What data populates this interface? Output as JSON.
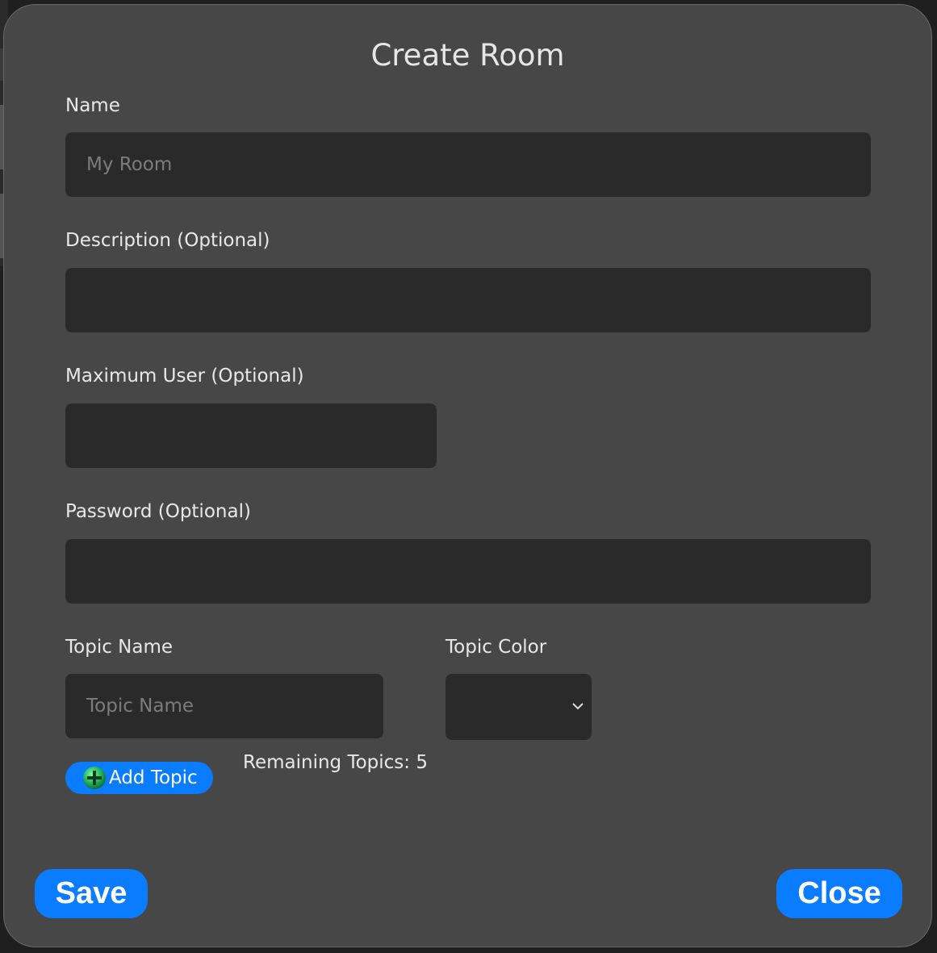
{
  "modal": {
    "title": "Create Room"
  },
  "form": {
    "name": {
      "label": "Name",
      "placeholder": "My Room",
      "value": ""
    },
    "description": {
      "label": "Description (Optional)",
      "placeholder": "",
      "value": ""
    },
    "max_user": {
      "label": "Maximum User (Optional)",
      "placeholder": "",
      "value": ""
    },
    "password": {
      "label": "Password (Optional)",
      "placeholder": "",
      "value": ""
    },
    "topic_name": {
      "label": "Topic Name",
      "placeholder": "Topic Name",
      "value": ""
    },
    "topic_color": {
      "label": "Topic Color",
      "selected": ""
    },
    "add_topic_label": "Add Topic",
    "remaining_topics": "Remaining Topics: 5"
  },
  "footer": {
    "save_label": "Save",
    "close_label": "Close"
  },
  "icons": {
    "add_topic": "plus-circle-icon",
    "select_caret": "chevron-down-icon"
  },
  "colors": {
    "accent": "#0a7cff",
    "modal_bg": "#474747",
    "field_bg": "#2a2a2a",
    "plus_icon": "#2ecc71"
  }
}
